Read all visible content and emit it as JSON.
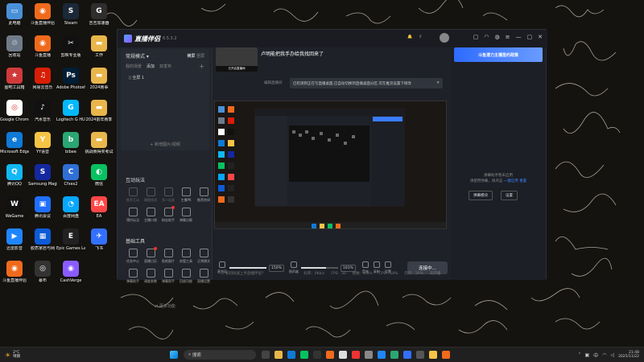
{
  "desktop": {
    "icons": [
      {
        "label": "此电脑",
        "color": "#4a90d9",
        "glyph": "▭"
      },
      {
        "label": "斗鱼直播伴侣",
        "color": "#f06a1d",
        "glyph": "◉"
      },
      {
        "label": "Steam",
        "color": "#1b2838",
        "glyph": "S"
      },
      {
        "label": "吉吉加速器",
        "color": "#2e2e2e",
        "glyph": "G"
      },
      {
        "label": "回收站",
        "color": "#6f7b8a",
        "glyph": "♲"
      },
      {
        "label": "斗鱼直播",
        "color": "#f06a1d",
        "glyph": "◉"
      },
      {
        "label": "剪映专业版",
        "color": "#111",
        "glyph": "✂"
      },
      {
        "label": "工作",
        "color": "#e8b64a",
        "glyph": "▬"
      },
      {
        "label": "图吧工具箱",
        "color": "#d13a3a",
        "glyph": "★"
      },
      {
        "label": "网易云音乐",
        "color": "#d81e06",
        "glyph": "♫"
      },
      {
        "label": "Adobe Photosh...",
        "color": "#001e36",
        "glyph": "Ps"
      },
      {
        "label": "2024赛事",
        "color": "#e8b64a",
        "glyph": "▬"
      },
      {
        "label": "Google Chrome",
        "color": "#ffffff",
        "glyph": "◎"
      },
      {
        "label": "汽水音乐",
        "color": "#111",
        "glyph": "♪"
      },
      {
        "label": "Logitech G HUB",
        "color": "#00b8fc",
        "glyph": "G"
      },
      {
        "label": "2024前年赛季",
        "color": "#e8b64a",
        "glyph": "▬"
      },
      {
        "label": "Microsoft Edge",
        "color": "#0f7ad7",
        "glyph": "e"
      },
      {
        "label": "YY语音",
        "color": "#f6c445",
        "glyph": "Y"
      },
      {
        "label": "bibee",
        "color": "#2aa673",
        "glyph": "b"
      },
      {
        "label": "挑战赛得奖考试",
        "color": "#e8b64a",
        "glyph": "▬"
      },
      {
        "label": "腾讯QQ",
        "color": "#12b7f5",
        "glyph": "Q"
      },
      {
        "label": "Samsung Magician",
        "color": "#1428a0",
        "glyph": "S"
      },
      {
        "label": "Cfxes2",
        "color": "#2f6fd6",
        "glyph": "C"
      },
      {
        "label": "微信",
        "color": "#07c160",
        "glyph": "◐"
      },
      {
        "label": "WeGame",
        "color": "#111",
        "glyph": "W"
      },
      {
        "label": "腾讯会议",
        "color": "#1f6fff",
        "glyph": "▣"
      },
      {
        "label": "百度网盘",
        "color": "#06a7ff",
        "glyph": "◔"
      },
      {
        "label": "EA",
        "color": "#ff4747",
        "glyph": "EA"
      },
      {
        "label": "迅雷影音",
        "color": "#1f85ff",
        "glyph": "▶"
      },
      {
        "label": "胶质家居与网",
        "color": "#0d5bd6",
        "glyph": "▦"
      },
      {
        "label": "Epic Games Launcher",
        "color": "#222",
        "glyph": "E"
      },
      {
        "label": "飞书",
        "color": "#3370ff",
        "glyph": "✈"
      },
      {
        "label": "斗鱼直播伴侣",
        "color": "#f06a1d",
        "glyph": "◉"
      },
      {
        "label": "幕布",
        "color": "#333",
        "glyph": "◎"
      },
      {
        "label": "CashVerge",
        "color": "#8a5cff",
        "glyph": "◉"
      }
    ]
  },
  "app": {
    "name": "直播伴侣",
    "version": "6.5.3.2",
    "left": {
      "mode_label": "常规模式",
      "landscape": "横屏",
      "portrait": "竖屏",
      "tabs": [
        "我的场景",
        "添加",
        "双发布"
      ],
      "scene": "全屏 1",
      "add_scene": "新增图片/视频",
      "interactive_title": "互动玩法",
      "interactive_tools": [
        "推荐互动",
        "幕题挑战",
        "多人连麦",
        "主播PK",
        "推荐房间",
        "预约玩法",
        "主播口袋",
        "粉丝助手",
        "弹幕点歌"
      ],
      "basic_title": "基础工具",
      "basic_tools": [
        "任务中心",
        "直播日历",
        "贴纸图片",
        "房管工具",
        "正常模式",
        "弹幕助手",
        "调度参数",
        "弹幕帮手",
        "回放功能",
        "直播设置"
      ],
      "more": "更多功能"
    },
    "center": {
      "thumb_caption": "已开启直播间",
      "room_title": "卢明能把我手办给我找回来了",
      "edit_label": "编辑直播间",
      "notice": "已检测到正在写直播桌面,已自动切换到直播桌面分区,可在推流设置下修改",
      "controls": {
        "mic_label": "麦克风",
        "mic_pct": "150%",
        "speaker_label": "扬声器",
        "speaker_pct": "101%",
        "effects_label": "音效",
        "record_label": "录制",
        "settings_label": "设置",
        "start": "连接中..."
      },
      "status": [
        "如何快速上手直播伴侣?",
        "码率：0Kb/s",
        "FPS：30",
        "帧数：0.0%",
        "CPU：18%",
        "内存：26%",
        "未开播"
      ]
    },
    "right": {
      "banner": "斗鱼潜力主播签约政策",
      "placeholder_line1": "弹幕助手暂未启用",
      "placeholder_line2": "请使用弹幕，请点击",
      "placeholder_link": "一键启用",
      "placeholder_link2": "重置",
      "btn1": "弹幕模块",
      "btn2": "设置"
    }
  },
  "taskbar": {
    "weather_temp": "2°C",
    "weather_text": "晴朗",
    "search_placeholder": "搜索",
    "time": "21:48",
    "date": "2025/11/22"
  }
}
